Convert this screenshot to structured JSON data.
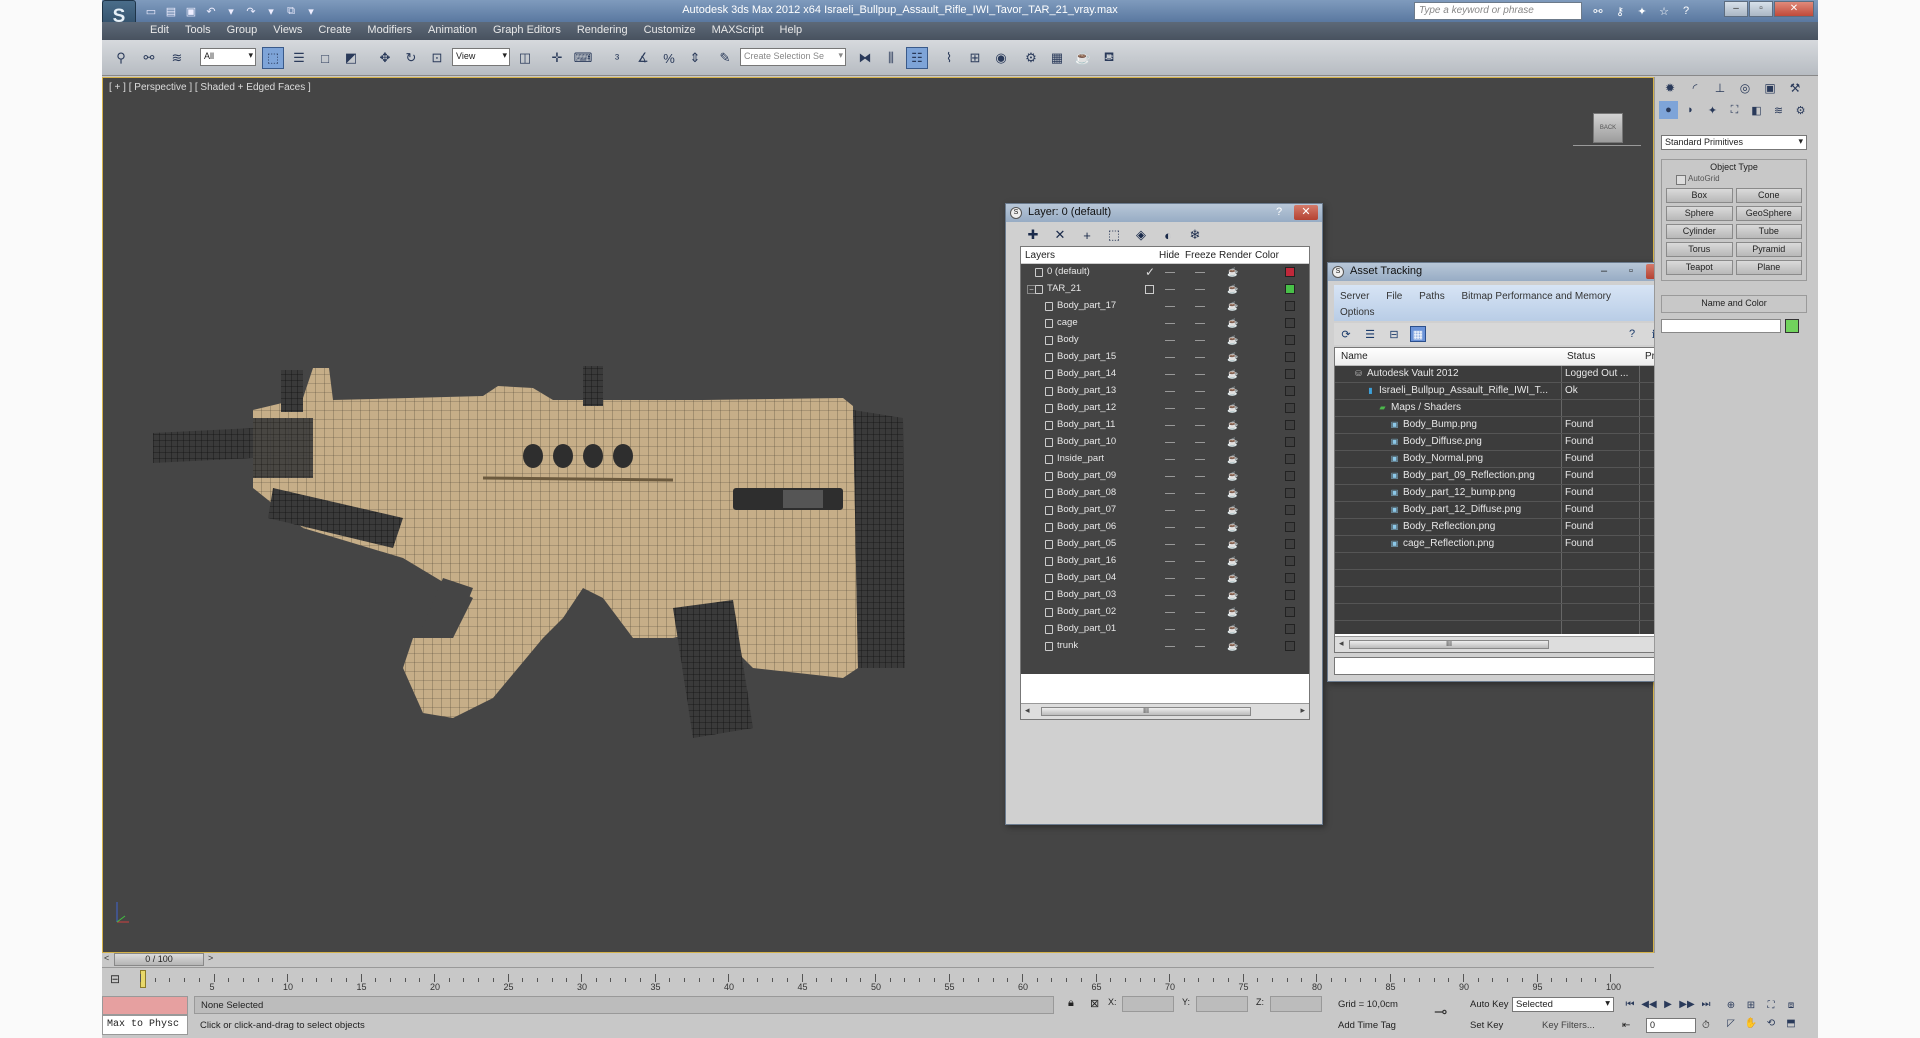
{
  "app": {
    "title": "Autodesk 3ds Max 2012 x64     Israeli_Bullpup_Assault_Rifle_IWI_Tavor_TAR_21_vray.max",
    "logo": "S",
    "search_placeholder": "Type a keyword or phrase"
  },
  "menu": [
    "Edit",
    "Tools",
    "Group",
    "Views",
    "Create",
    "Modifiers",
    "Animation",
    "Graph Editors",
    "Rendering",
    "Customize",
    "MAXScript",
    "Help"
  ],
  "toolbar": {
    "selection_filter": "All",
    "ref_coord": "View",
    "named_selection_placeholder": "Create Selection Se"
  },
  "viewport": {
    "label": "[ + ] [ Perspective ] [ Shaded + Edged Faces ]",
    "viewcube_label": "BACK"
  },
  "command_panel": {
    "category": "Standard Primitives",
    "object_type_title": "Object Type",
    "autogrid_label": "AutoGrid",
    "primitives": [
      "Box",
      "Cone",
      "Sphere",
      "GeoSphere",
      "Cylinder",
      "Tube",
      "Torus",
      "Pyramid",
      "Teapot",
      "Plane"
    ],
    "name_color_title": "Name and Color",
    "object_color": "#71d35d"
  },
  "layer_dialog": {
    "title": "Layer: 0 (default)",
    "help": "?",
    "close": "✕",
    "columns": {
      "layers": "Layers",
      "hide": "Hide",
      "freeze": "Freeze",
      "render": "Render",
      "color": "Color"
    },
    "rows": [
      {
        "name": "0 (default)",
        "color": "#c0283a",
        "level": 0
      },
      {
        "name": "TAR_21",
        "color": "#48c048",
        "level": 0
      },
      {
        "name": "Body_part_17",
        "color": "#404040",
        "level": 1
      },
      {
        "name": "cage",
        "color": "#404040",
        "level": 1
      },
      {
        "name": "Body",
        "color": "#404040",
        "level": 1
      },
      {
        "name": "Body_part_15",
        "color": "#404040",
        "level": 1
      },
      {
        "name": "Body_part_14",
        "color": "#404040",
        "level": 1
      },
      {
        "name": "Body_part_13",
        "color": "#404040",
        "level": 1
      },
      {
        "name": "Body_part_12",
        "color": "#404040",
        "level": 1
      },
      {
        "name": "Body_part_11",
        "color": "#404040",
        "level": 1
      },
      {
        "name": "Body_part_10",
        "color": "#404040",
        "level": 1
      },
      {
        "name": "Inside_part",
        "color": "#404040",
        "level": 1
      },
      {
        "name": "Body_part_09",
        "color": "#404040",
        "level": 1
      },
      {
        "name": "Body_part_08",
        "color": "#404040",
        "level": 1
      },
      {
        "name": "Body_part_07",
        "color": "#404040",
        "level": 1
      },
      {
        "name": "Body_part_06",
        "color": "#404040",
        "level": 1
      },
      {
        "name": "Body_part_05",
        "color": "#404040",
        "level": 1
      },
      {
        "name": "Body_part_16",
        "color": "#404040",
        "level": 1
      },
      {
        "name": "Body_part_04",
        "color": "#404040",
        "level": 1
      },
      {
        "name": "Body_part_03",
        "color": "#404040",
        "level": 1
      },
      {
        "name": "Body_part_02",
        "color": "#404040",
        "level": 1
      },
      {
        "name": "Body_part_01",
        "color": "#404040",
        "level": 1
      },
      {
        "name": "trunk",
        "color": "#404040",
        "level": 1
      }
    ]
  },
  "asset_tracking": {
    "title": "Asset Tracking",
    "menu": [
      "Server",
      "File",
      "Paths",
      "Bitmap Performance and Memory",
      "Options"
    ],
    "columns": {
      "name": "Name",
      "status": "Status",
      "proxy": "Prox"
    },
    "rows": [
      {
        "name": "Autodesk Vault 2012",
        "status": "Logged Out ...",
        "level": 0,
        "icon": "vault"
      },
      {
        "name": "Israeli_Bullpup_Assault_Rifle_IWI_T...",
        "status": "Ok",
        "level": 1,
        "icon": "max"
      },
      {
        "name": "Maps / Shaders",
        "status": "",
        "level": 2,
        "icon": "folder"
      },
      {
        "name": "Body_Bump.png",
        "status": "Found",
        "level": 3,
        "icon": "image"
      },
      {
        "name": "Body_Diffuse.png",
        "status": "Found",
        "level": 3,
        "icon": "image"
      },
      {
        "name": "Body_Normal.png",
        "status": "Found",
        "level": 3,
        "icon": "image"
      },
      {
        "name": "Body_part_09_Reflection.png",
        "status": "Found",
        "level": 3,
        "icon": "image"
      },
      {
        "name": "Body_part_12_bump.png",
        "status": "Found",
        "level": 3,
        "icon": "image"
      },
      {
        "name": "Body_part_12_Diffuse.png",
        "status": "Found",
        "level": 3,
        "icon": "image"
      },
      {
        "name": "Body_Reflection.png",
        "status": "Found",
        "level": 3,
        "icon": "image"
      },
      {
        "name": "cage_Reflection.png",
        "status": "Found",
        "level": 3,
        "icon": "image"
      }
    ]
  },
  "timeline": {
    "slider_label": "0 / 100",
    "ticks": [
      5,
      10,
      15,
      20,
      25,
      30,
      35,
      40,
      45,
      50,
      55,
      60,
      65,
      70,
      75,
      80,
      85,
      90,
      95,
      100
    ]
  },
  "status": {
    "maxscript": "Max to Physc",
    "selection": "None Selected",
    "hint": "Click or click-and-drag to select objects",
    "x_label": "X:",
    "y_label": "Y:",
    "z_label": "Z:",
    "grid": "Grid = 10,0cm",
    "add_time_tag": "Add Time Tag",
    "auto_key": "Auto Key",
    "auto_key_mode": "Selected",
    "set_key": "Set Key",
    "key_filters": "Key Filters...",
    "frame": "0"
  }
}
